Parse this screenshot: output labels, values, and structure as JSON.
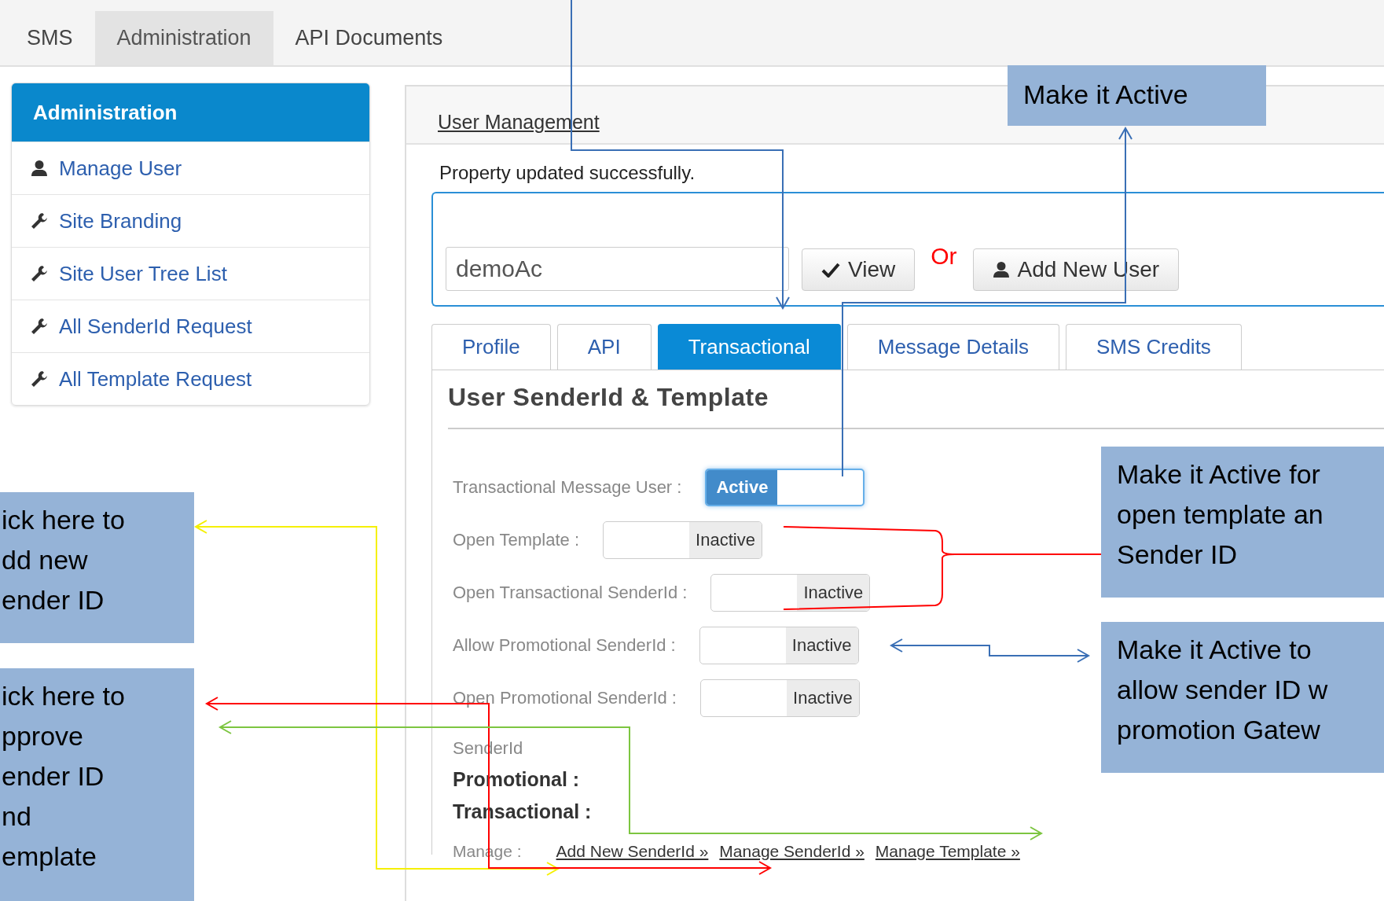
{
  "top_nav": {
    "tabs": [
      {
        "label": "SMS",
        "selected": false
      },
      {
        "label": "Administration",
        "selected": true
      },
      {
        "label": "API Documents",
        "selected": false
      }
    ]
  },
  "sidebar": {
    "title": "Administration",
    "items": [
      {
        "label": "Manage User",
        "kind": "account"
      },
      {
        "label": "Site Branding",
        "kind": "tool"
      },
      {
        "label": "Site User Tree List",
        "kind": "tool"
      },
      {
        "label": "All SenderId Request",
        "kind": "tool"
      },
      {
        "label": "All Template Request",
        "kind": "tool"
      }
    ]
  },
  "main": {
    "title": "User Management",
    "message": "Property updated successfully.",
    "search": {
      "value": "demoAc"
    },
    "view_button": "View",
    "or_label": "Or",
    "add_user_button": "Add New User",
    "tabs": [
      {
        "label": "Profile",
        "selected": false
      },
      {
        "label": "API",
        "selected": false
      },
      {
        "label": "Transactional",
        "selected": true
      },
      {
        "label": "Message Details",
        "selected": false
      },
      {
        "label": "SMS Credits",
        "selected": false
      }
    ],
    "section_title": "User SenderId & Template",
    "settings": [
      {
        "label": "Transactional Message User :",
        "state": "Active",
        "on": true
      },
      {
        "label": "Open Template :",
        "state": "Inactive",
        "on": false
      },
      {
        "label": "Open Transactional SenderId :",
        "state": "Inactive",
        "on": false
      },
      {
        "label": "Allow Promotional SenderId :",
        "state": "Inactive",
        "on": false
      },
      {
        "label": "Open Promotional SenderId :",
        "state": "Inactive",
        "on": false
      }
    ],
    "senderid_label": "SenderId",
    "promotional_label": "Promotional :",
    "transactional_label": "Transactional :",
    "manage_label": "Manage :",
    "manage_links": [
      "Add New SenderId »",
      "Manage SenderId »",
      "Manage Template »"
    ]
  },
  "annotations": {
    "callouts": [
      {
        "lines": [
          "Make it Active"
        ]
      },
      {
        "lines": [
          "Make it Active for",
          "open template an",
          "Sender ID"
        ]
      },
      {
        "lines": [
          "Make it Active to",
          "allow sender ID w",
          "promotion Gatew"
        ]
      },
      {
        "lines": [
          "ick here to",
          "dd new",
          "ender ID"
        ]
      },
      {
        "lines": [
          "ick here to",
          "pprove",
          "ender ID",
          "nd",
          "emplate"
        ]
      }
    ]
  }
}
